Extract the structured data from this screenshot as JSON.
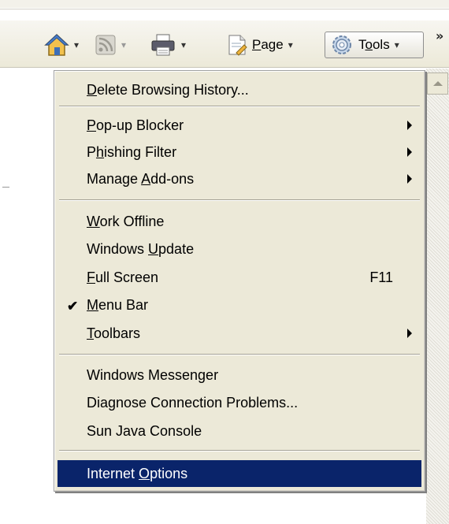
{
  "toolbar": {
    "page_label_pre": "",
    "page_label_u": "P",
    "page_label_post": "age",
    "tools_label_pre": "T",
    "tools_label_u": "o",
    "tools_label_post": "ols",
    "dropdown_glyph": "▾",
    "overflow_glyph": "»"
  },
  "menu": {
    "items": [
      {
        "pre": "",
        "u": "D",
        "post": "elete Browsing History...",
        "shortcut": "",
        "submenu": false,
        "checked": false
      },
      {
        "pre": "",
        "u": "P",
        "post": "op-up Blocker",
        "shortcut": "",
        "submenu": true,
        "checked": false
      },
      {
        "pre": "P",
        "u": "h",
        "post": "ishing Filter",
        "shortcut": "",
        "submenu": true,
        "checked": false
      },
      {
        "pre": "Manage ",
        "u": "A",
        "post": "dd-ons",
        "shortcut": "",
        "submenu": true,
        "checked": false
      },
      {
        "pre": "",
        "u": "W",
        "post": "ork Offline",
        "shortcut": "",
        "submenu": false,
        "checked": false
      },
      {
        "pre": "Windows ",
        "u": "U",
        "post": "pdate",
        "shortcut": "",
        "submenu": false,
        "checked": false
      },
      {
        "pre": "",
        "u": "F",
        "post": "ull Screen",
        "shortcut": "F11",
        "submenu": false,
        "checked": false
      },
      {
        "pre": "",
        "u": "M",
        "post": "enu Bar",
        "shortcut": "",
        "submenu": false,
        "checked": true
      },
      {
        "pre": "",
        "u": "T",
        "post": "oolbars",
        "shortcut": "",
        "submenu": true,
        "checked": false
      },
      {
        "pre": "Windows Messenger",
        "u": "",
        "post": "",
        "shortcut": "",
        "submenu": false,
        "checked": false
      },
      {
        "pre": "Diagnose Connection Problems...",
        "u": "",
        "post": "",
        "shortcut": "",
        "submenu": false,
        "checked": false
      },
      {
        "pre": "Sun Java Console",
        "u": "",
        "post": "",
        "shortcut": "",
        "submenu": false,
        "checked": false
      },
      {
        "pre": "Internet ",
        "u": "O",
        "post": "ptions",
        "shortcut": "",
        "submenu": false,
        "checked": false
      }
    ],
    "check_glyph": "✔"
  },
  "colors": {
    "menu_bg": "#ece9d8",
    "highlight": "#0a246a"
  }
}
